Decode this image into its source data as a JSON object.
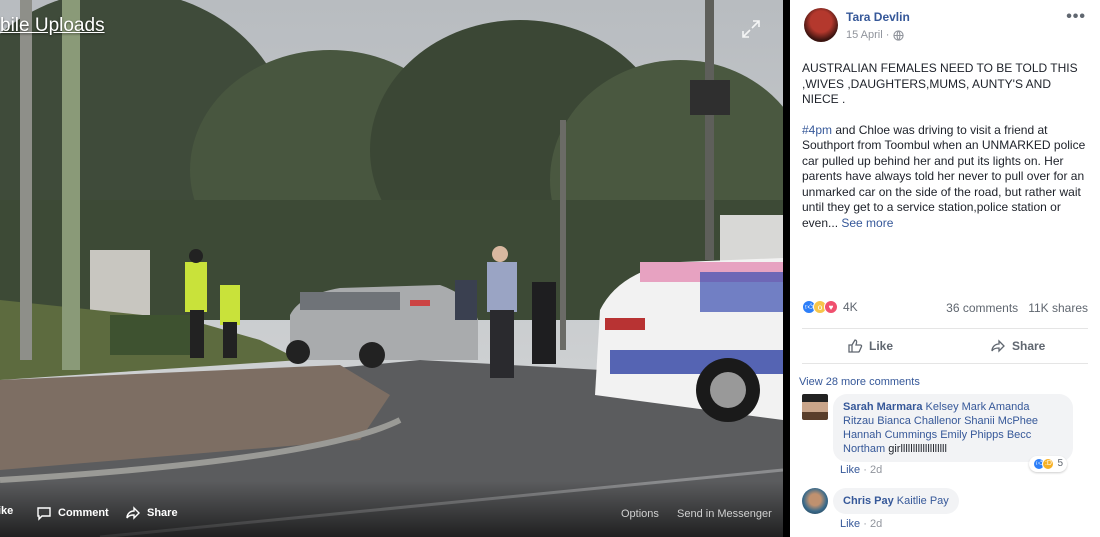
{
  "photo": {
    "album_link": "bile Uploads",
    "actions": {
      "like": "ike",
      "comment": "Comment",
      "share": "Share",
      "options": "Options",
      "send_in_messenger": "Send in Messenger"
    }
  },
  "post": {
    "author": "Tara Devlin",
    "date": "15 April ·",
    "paragraph1": "AUSTRALIAN FEMALES NEED TO BE TOLD THIS ,WIVES ,DAUGHTERS,MUMS, AUNTY'S AND NIECE .",
    "hashtag": "#4pm",
    "paragraph2": " and Chloe was driving to visit a friend at Southport from Toombul when an UNMARKED police car pulled up behind her and put its lights on. Her parents have always told her never to pull over for an unmarked car on the side of the road, but rather wait until they get to a service station,police station or even... ",
    "see_more": "See more",
    "reactions_count": "4K",
    "comments_count": "36 comments",
    "shares_count": "11K shares",
    "like_label": "Like",
    "share_label": "Share",
    "view_more_comments": "View 28 more comments"
  },
  "comments": [
    {
      "name": "Sarah Marmara",
      "tags": " Kelsey Mark Amanda Ritzau Bianca Challenor Shanii McPhee Hannah Cummings Emily Phipps Becc Northam",
      "text": " girlllllllllllllllllll",
      "like": "Like",
      "time": "2d",
      "reaction_count": "5"
    },
    {
      "name": "Chris Pay",
      "tags": " Kaitlie Pay",
      "text": "",
      "like": "Like",
      "time": "2d"
    }
  ],
  "colors": {
    "link": "#365899",
    "text": "#1d2129",
    "muted": "#90949c"
  }
}
